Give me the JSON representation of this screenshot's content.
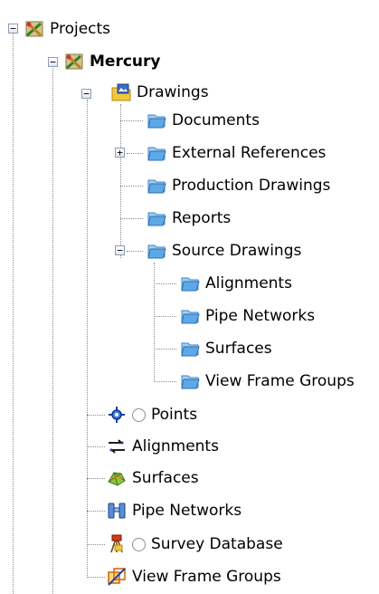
{
  "tree": {
    "root": {
      "label": "Projects",
      "icon": "projects-icon",
      "expanded": true
    },
    "project": {
      "label": "Mercury",
      "icon": "project-icon",
      "expanded": true
    },
    "drawings": {
      "label": "Drawings",
      "icon": "drawings-folder-icon",
      "expanded": true,
      "children": [
        {
          "label": "Documents",
          "icon": "folder-icon"
        },
        {
          "label": "External References",
          "icon": "folder-icon",
          "expandable": true
        },
        {
          "label": "Production Drawings",
          "icon": "folder-icon"
        },
        {
          "label": "Reports",
          "icon": "folder-icon"
        },
        {
          "label": "Source Drawings",
          "icon": "folder-icon",
          "expanded": true,
          "children": [
            {
              "label": "Alignments",
              "icon": "folder-icon"
            },
            {
              "label": "Pipe Networks",
              "icon": "folder-icon"
            },
            {
              "label": "Surfaces",
              "icon": "folder-icon"
            },
            {
              "label": "View Frame Groups",
              "icon": "folder-icon"
            }
          ]
        }
      ]
    },
    "items": [
      {
        "label": "Points",
        "icon": "points-icon",
        "radio": true
      },
      {
        "label": "Alignments",
        "icon": "alignments-icon"
      },
      {
        "label": "Surfaces",
        "icon": "surfaces-icon"
      },
      {
        "label": "Pipe Networks",
        "icon": "pipe-networks-icon"
      },
      {
        "label": "Survey Database",
        "icon": "survey-database-icon",
        "radio": true
      },
      {
        "label": "View Frame Groups",
        "icon": "view-frame-groups-icon"
      }
    ],
    "colors": {
      "folder": "#5fa8e8",
      "connector": "#8a8a8a",
      "expander_border": "#8a9db6"
    }
  }
}
